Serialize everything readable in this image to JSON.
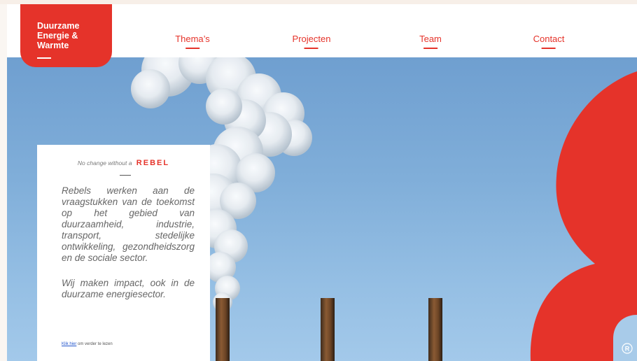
{
  "brand": {
    "title": "Duurzame Energie & Warmte",
    "lines": [
      "Duurzame",
      "Energie &",
      "Warmte"
    ]
  },
  "nav": {
    "items": [
      "Thema’s",
      "Projecten",
      "Team",
      "Contact"
    ]
  },
  "panel": {
    "tagline_prefix": "No change without a",
    "tagline_brand": "REBEL",
    "paragraph1": "Rebels werken aan de vraagstukken van de toekomst op het gebied van duurzaamheid, industrie, transport, stedelijke ontwikkeling, gezondheidszorg en de sociale sector.",
    "paragraph2": "Wij maken impact, ook in de duurzame energiesector.",
    "link_text": "Klik hier",
    "link_suffix": " om verder te lezen"
  },
  "badge": {
    "letter": "R"
  },
  "colors": {
    "accent": "#e5332a",
    "sky": "#80aed9",
    "panel": "#ffffff"
  }
}
